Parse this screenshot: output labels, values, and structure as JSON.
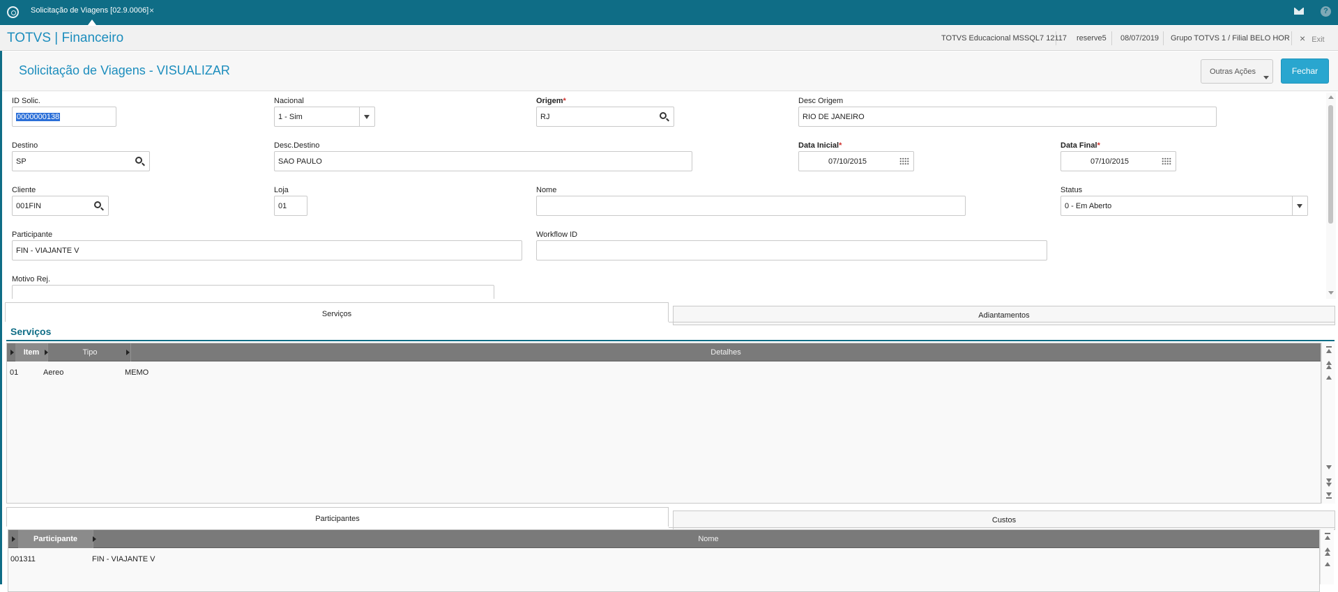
{
  "topbar": {
    "tab_title": "Solicitação de Viagens [02.9.0006]",
    "tab_close": "×"
  },
  "appbar": {
    "brand": "TOTVS | Financeiro",
    "environment": "TOTVS Educacional MSSQL7 12117",
    "user": "reserve5",
    "date": "08/07/2019",
    "branch": "Grupo TOTVS 1 / Filial BELO HOR",
    "exit_label": "Exit",
    "exit_icon": "×"
  },
  "page": {
    "title": "Solicitação de Viagens - VISUALIZAR"
  },
  "actions": {
    "outras_acoes": "Outras Ações",
    "fechar": "Fechar"
  },
  "fields": {
    "id_solic": {
      "label": "ID Solic.",
      "value": "0000000138"
    },
    "nacional": {
      "label": "Nacional",
      "value": "1 - Sim"
    },
    "origem": {
      "label": "Origem",
      "required": "*",
      "value": "RJ"
    },
    "desc_origem": {
      "label": "Desc Origem",
      "value": "RIO DE JANEIRO"
    },
    "destino": {
      "label": "Destino",
      "value": "SP"
    },
    "desc_destino": {
      "label": "Desc.Destino",
      "value": "SAO PAULO"
    },
    "data_inicial": {
      "label": "Data Inicial",
      "required": "*",
      "value": "07/10/2015"
    },
    "data_final": {
      "label": "Data Final",
      "required": "*",
      "value": "07/10/2015"
    },
    "cliente": {
      "label": "Cliente",
      "value": "001FIN"
    },
    "loja": {
      "label": "Loja",
      "value": "01"
    },
    "nome": {
      "label": "Nome",
      "value": ""
    },
    "status": {
      "label": "Status",
      "value": "0 - Em Aberto"
    },
    "participante": {
      "label": "Participante",
      "value": "FIN - VIAJANTE V"
    },
    "workflow_id": {
      "label": "Workflow ID",
      "value": ""
    },
    "motivo_rej": {
      "label": "Motivo Rej.",
      "value": ""
    }
  },
  "folders_top": {
    "tabs": [
      "Serviços",
      "Adiantamentos"
    ],
    "active": "Serviços"
  },
  "servicos": {
    "section_title": "Serviços",
    "columns": [
      "Item",
      "Tipo",
      "Detalhes"
    ],
    "rows": [
      {
        "item": "01",
        "tipo": "Aereo",
        "detalhes": "MEMO"
      }
    ]
  },
  "folders_bottom": {
    "tabs": [
      "Participantes",
      "Custos"
    ],
    "active": "Participantes"
  },
  "participantes": {
    "columns": [
      "Participante",
      "Nome"
    ],
    "rows": [
      {
        "participante": "001311",
        "nome": "FIN - VIAJANTE V"
      }
    ]
  },
  "icons": {
    "home": "totvs-home-icon",
    "mail": "mail-icon",
    "help": "help-icon",
    "help_glyph": "?",
    "search": "search-icon",
    "calendar": "calendar-icon",
    "dropdown": "chevron-down-icon"
  },
  "colors": {
    "topbar": "#0f6d86",
    "brand": "#1c8dbd",
    "primary_button": "#29a6cf",
    "required": "#d0312d",
    "grid_header": "#7a7a7a"
  }
}
